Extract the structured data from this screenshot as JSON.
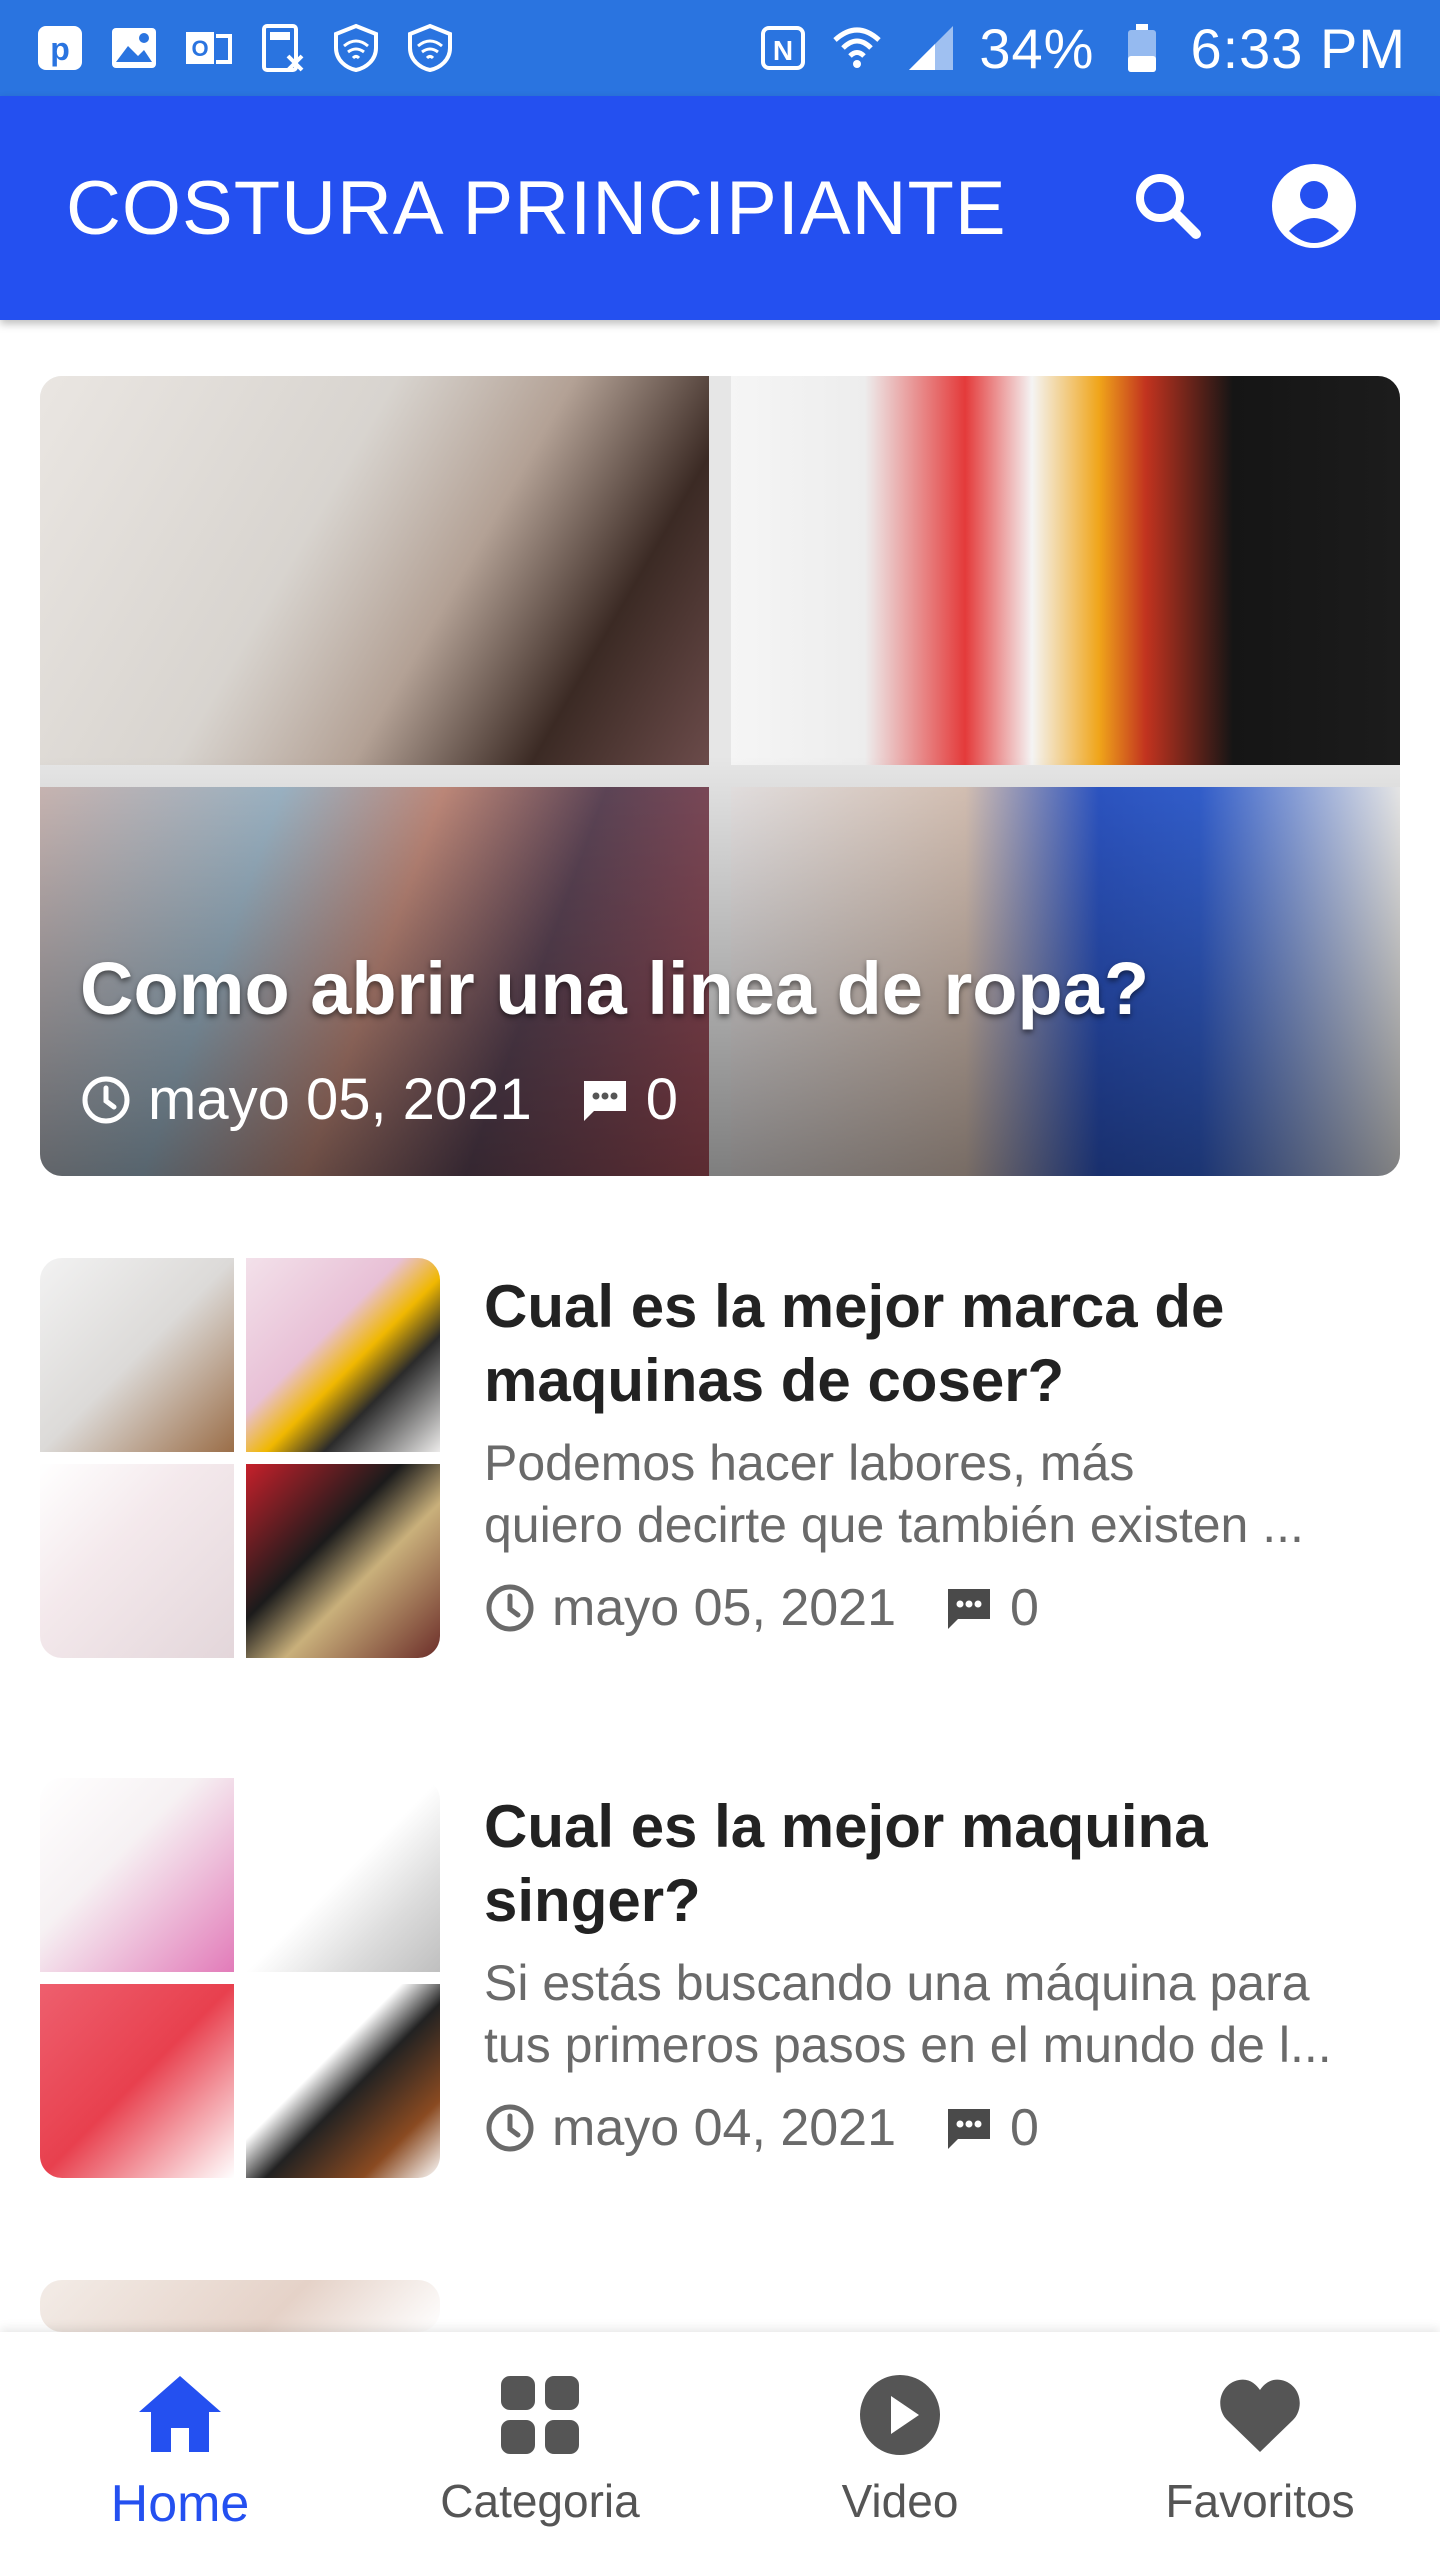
{
  "status_bar": {
    "battery": "34%",
    "time": "6:33 PM",
    "left_icons": [
      "p-app-icon",
      "image-icon",
      "outlook-icon",
      "calculator-icon",
      "shield-icon",
      "shield-icon"
    ],
    "right_icons": [
      "nfc-icon",
      "wifi-icon",
      "signal-icon",
      "battery-icon"
    ]
  },
  "app_bar": {
    "title": "COSTURA PRINCIPIANTE",
    "actions": [
      "search-icon",
      "account-icon"
    ]
  },
  "hero": {
    "title": "Como abrir una linea de ropa?",
    "date": "mayo 05, 2021",
    "comments": "0"
  },
  "articles": [
    {
      "title_line1": "Cual es la mejor marca de",
      "title_line2": "maquinas de coser?",
      "excerpt_line1": "Podemos hacer labores, más",
      "excerpt_line2": "quiero decirte que también existen ...",
      "date": "mayo 05, 2021",
      "comments": "0"
    },
    {
      "title_line1": "Cual es la mejor maquina",
      "title_line2": "singer?",
      "excerpt_line1": "Si estás buscando una máquina para",
      "excerpt_line2": "tus primeros pasos en el mundo de l...",
      "date": "mayo 04, 2021",
      "comments": "0"
    }
  ],
  "bottom_nav": {
    "items": [
      {
        "label": "Home",
        "icon": "home-icon",
        "active": true
      },
      {
        "label": "Categoria",
        "icon": "category-icon",
        "active": false
      },
      {
        "label": "Video",
        "icon": "play-icon",
        "active": false
      },
      {
        "label": "Favoritos",
        "icon": "heart-icon",
        "active": false
      }
    ]
  },
  "colors": {
    "status_bar": "#2a74e0",
    "app_bar": "#2450f0",
    "active_nav": "#2450f0",
    "inactive_nav": "#555555"
  }
}
